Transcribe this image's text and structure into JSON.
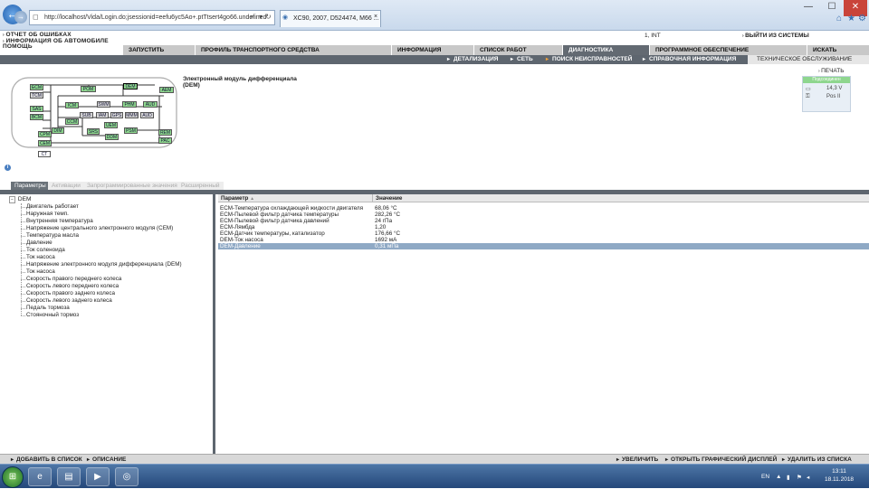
{
  "browser": {
    "address": "http://localhost/Vida/Login.do;jsessionid=eefu6yc5Ao+.ptTtsert4go66.undefined",
    "tab_title": "XC90, 2007, D524474, M66 ...",
    "win_minimize": "—",
    "win_maximize": "☐",
    "win_close": "✕"
  },
  "topleft": [
    "ОТЧЕТ ОБ ОШИБКАХ",
    "ИНФОРМАЦИЯ ОБ АВТОМОБИЛЕ",
    "ПОМОЩЬ"
  ],
  "user": "1, INT",
  "logout": "ВЫЙТИ ИЗ СИСТЕМЫ",
  "main_tabs": [
    "ЗАПУСТИТЬ",
    "ПРОФИЛЬ ТРАНСПОРТНОГО СРЕДСТВА",
    "ИНФОРМАЦИЯ",
    "СПИСОК РАБОТ",
    "ДИАГНОСТИКА",
    "ПРОГРАММНОЕ ОБЕСПЕЧЕНИЕ",
    "ИСКАТЬ"
  ],
  "sub_tabs": [
    "ДЕТАЛИЗАЦИЯ",
    "СЕТЬ",
    "ПОИСК НЕИСПРАВНОСТЕЙ",
    "СПРАВОЧНАЯ ИНФОРМАЦИЯ",
    "ТЕХНИЧЕСКОЕ ОБСЛУЖИВАНИЕ"
  ],
  "modules": [
    "ECM",
    "TCM",
    "POM",
    "DEM",
    "AEM",
    "SAS",
    "BCM",
    "ICM",
    "SWM",
    "PHM",
    "AUD",
    "SUB",
    "IAM",
    "GPS",
    "MMM",
    "AUD",
    "CCM",
    "UEM",
    "DIM",
    "SRS",
    "DDM",
    "PSM",
    "REM",
    "PAC",
    "CPM",
    "CEM",
    "CT"
  ],
  "module_title": "Электронный модуль дифференциала",
  "module_code": "(DEM)",
  "print": "ПЕЧАТЬ",
  "connection": {
    "status": "Подсоединен",
    "voltage": "14,3 V",
    "position": "Pos II"
  },
  "param_tabs": [
    "Параметры",
    "Активации",
    "Запрограммированные значения",
    "Расширенный"
  ],
  "tree": {
    "root": "DEM",
    "items": [
      "Двигатель работает",
      "Наружная темп.",
      "Внутренняя температура",
      "Напряжение центрального электронного модуля (CEM)",
      "Температура масла",
      "Давление",
      "Ток соленоида",
      "Ток насоса",
      "Напряжение электронного модуля дифференциала (DEM)",
      "Ток насоса",
      "Скорость правого переднего колеса",
      "Скорость левого переднего колеса",
      "Скорость правого заднего колеса",
      "Скорость левого заднего колеса",
      "Педаль тормоза",
      "Стояночный тормоз"
    ]
  },
  "grid": {
    "headers": [
      "Параметр",
      "Значение"
    ],
    "sort_icon": "▲",
    "rows": [
      [
        "ECM-Температура охлаждающей жидкости двигателя",
        "68,06 °C"
      ],
      [
        "ECM-Пылевой фильтр датчика температуры",
        "282,26 °C"
      ],
      [
        "ECM-Пылевой фильтр датчика давлений",
        "24 гПа"
      ],
      [
        "ECM-Лямбда",
        "1,20"
      ],
      [
        "ECM-Датчик температуры, катализатор",
        "176,66 °C"
      ],
      [
        "DEM-Ток насоса",
        "1692 мА"
      ],
      [
        "DEM-Давление",
        "0,31 мПа"
      ]
    ]
  },
  "footer": {
    "add": "ДОБАВИТЬ В СПИСОК",
    "desc": "ОПИСАНИЕ",
    "zoom": "УВЕЛИЧИТЬ",
    "graph": "ОТКРЫТЬ ГРАФИЧЕСКИЙ ДИСПЛЕЙ",
    "remove": "УДАЛИТЬ ИЗ СПИСКА"
  },
  "tray": {
    "lang": "EN",
    "time": "13:11",
    "date": "18.11.2018"
  }
}
